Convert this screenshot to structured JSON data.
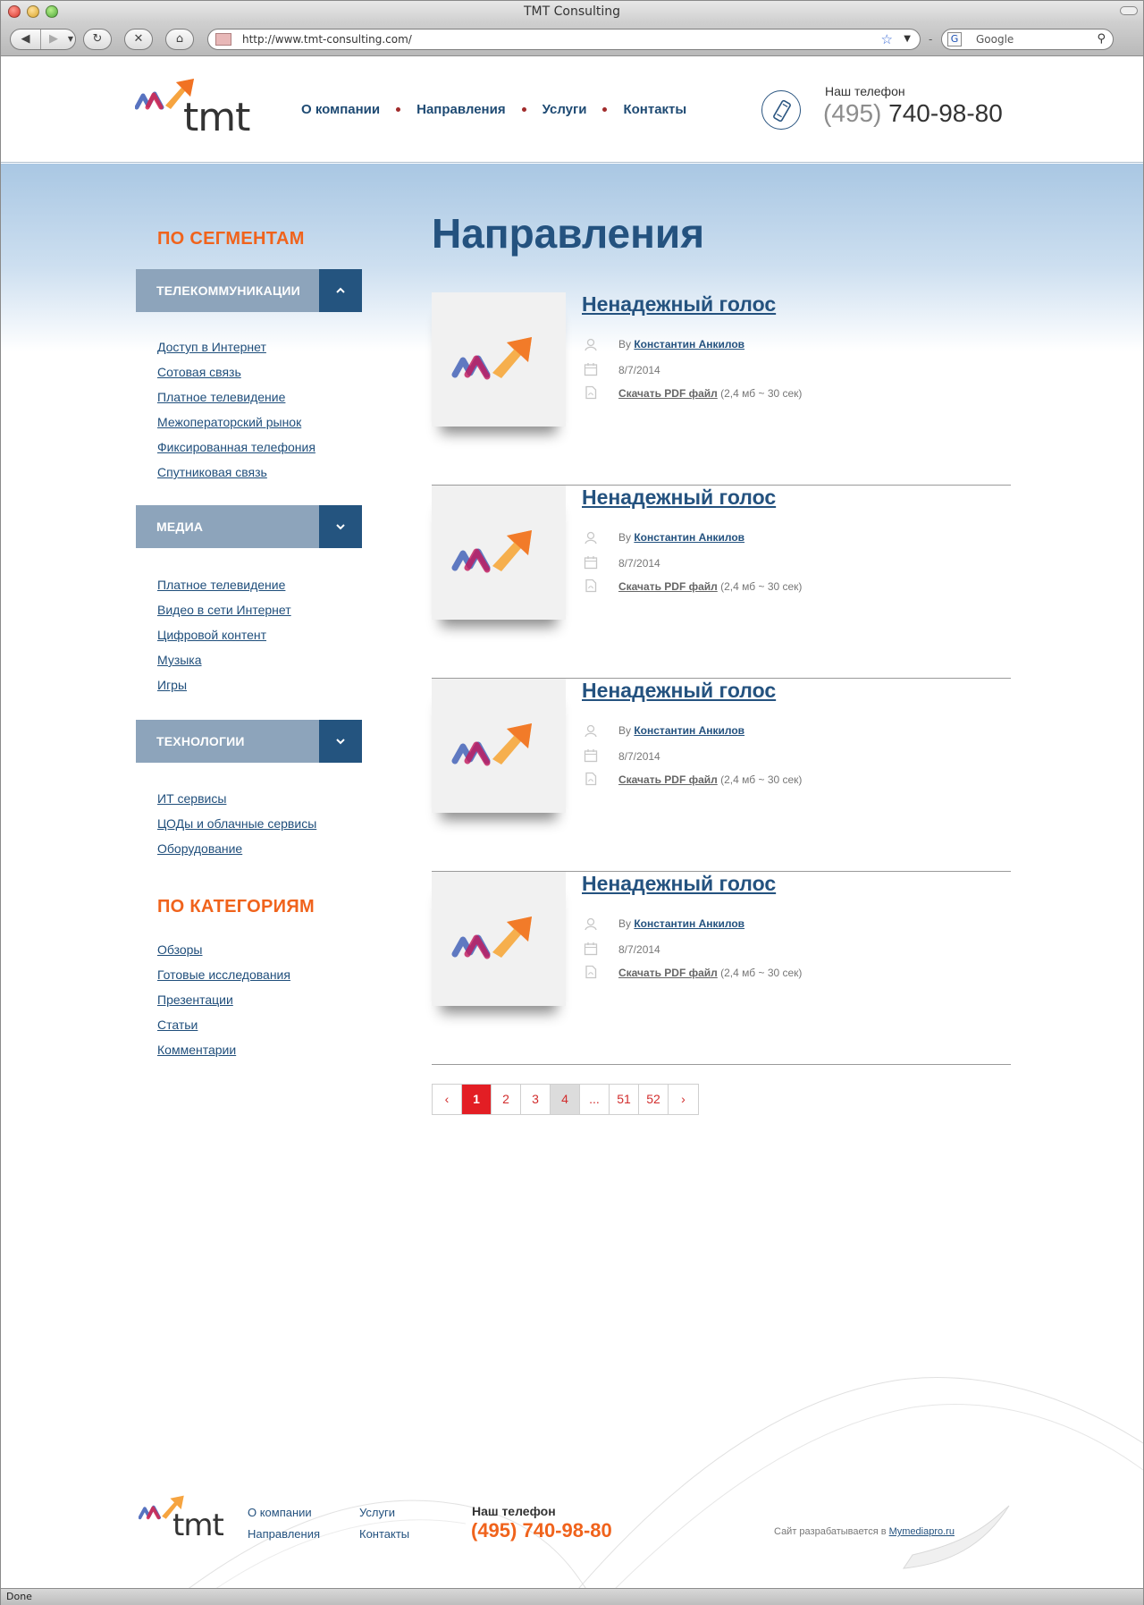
{
  "browser": {
    "window_title": "TMT Consulting",
    "url": "http://www.tmt-consulting.com/",
    "search_placeholder": "Google",
    "status": "Done"
  },
  "header": {
    "logo_text": "tmt",
    "nav": [
      "О компании",
      "Направления",
      "Услуги",
      "Контакты"
    ],
    "phone_label": "Наш телефон",
    "phone_code": "(495)",
    "phone_number": "740-98-80"
  },
  "sidebar": {
    "segments_title": "ПО СЕГМЕНТАМ",
    "groups": [
      {
        "label": "ТЕЛЕКОММУНИКАЦИИ",
        "expanded": true,
        "links": [
          "Доступ в Интернет",
          "Сотовая связь",
          "Платное телевидение",
          "Межоператорский рынок",
          "Фиксированная телефония",
          "Спутниковая связь"
        ]
      },
      {
        "label": "МЕДИА",
        "expanded": false,
        "links": [
          "Платное телевидение",
          "Видео в сети Интернет",
          "Цифровой контент",
          "Музыка",
          "Игры"
        ]
      },
      {
        "label": "ТЕХНОЛОГИИ",
        "expanded": false,
        "links": [
          "ИТ сервисы",
          "ЦОДы и облачные сервисы",
          "Оборудование"
        ]
      }
    ],
    "categories_title": "ПО КАТЕГОРИЯМ",
    "categories": [
      "Обзоры",
      "Готовые исследования",
      "Презентации",
      "Статьи",
      "Комментарии"
    ]
  },
  "main": {
    "title": "Направления",
    "articles": [
      {
        "title": "Ненадежный голос",
        "by": "By",
        "author": "Константин Анкилов",
        "date": "8/7/2014",
        "pdf_link": "Скачать PDF файл",
        "pdf_info": "(2,4 мб ~ 30 сек)"
      },
      {
        "title": "Ненадежный голос",
        "by": "By",
        "author": "Константин Анкилов",
        "date": "8/7/2014",
        "pdf_link": "Скачать PDF файл",
        "pdf_info": "(2,4 мб ~ 30 сек)"
      },
      {
        "title": "Ненадежный голос",
        "by": "By",
        "author": "Константин Анкилов",
        "date": "8/7/2014",
        "pdf_link": "Скачать PDF файл",
        "pdf_info": "(2,4 мб ~ 30 сек)"
      },
      {
        "title": "Ненадежный голос",
        "by": "By",
        "author": "Константин Анкилов",
        "date": "8/7/2014",
        "pdf_link": "Скачать PDF файл",
        "pdf_info": "(2,4 мб ~ 30 сек)"
      }
    ],
    "pagination": {
      "prev": "‹",
      "pages": [
        "1",
        "2",
        "3",
        "4",
        "...",
        "51",
        "52"
      ],
      "current": "1",
      "hovered": "4",
      "next": "›"
    }
  },
  "footer": {
    "logo_text": "tmt",
    "links_col1": [
      "О компании",
      "Направления"
    ],
    "links_col2": [
      "Услуги",
      "Контакты"
    ],
    "phone_label": "Наш телефон",
    "phone": "(495) 740-98-80",
    "credit_text": "Сайт разрабатывается в",
    "credit_link": "Mymediapro.ru"
  },
  "colors": {
    "brand_blue": "#24527f",
    "accent_orange": "#f0631c",
    "accordion_gray": "#8da4bb",
    "accordion_dark": "#24547f",
    "pager_active": "#e31e24"
  }
}
